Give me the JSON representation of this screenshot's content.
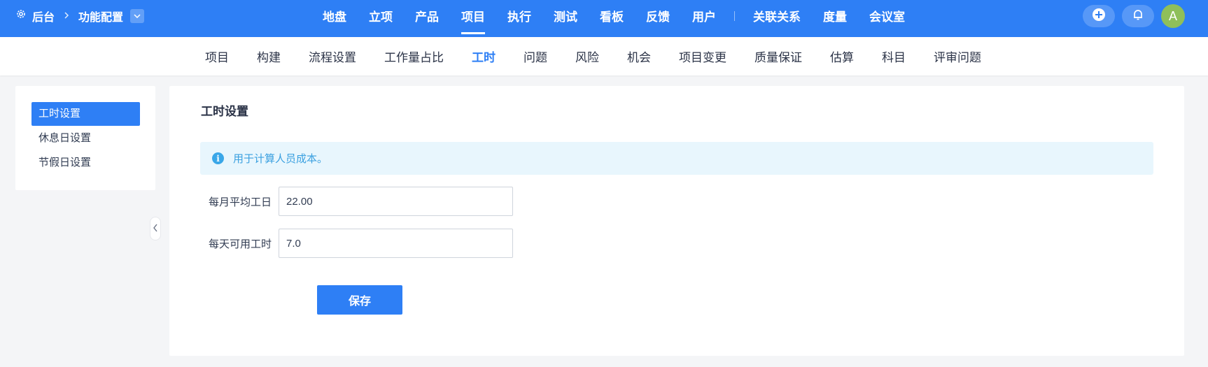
{
  "header": {
    "breadcrumb_home": "后台",
    "breadcrumb_section": "功能配置",
    "nav": [
      "地盘",
      "立项",
      "产品",
      "项目",
      "执行",
      "测试",
      "看板",
      "反馈",
      "用户"
    ],
    "nav_extra": [
      "关联关系",
      "度量",
      "会议室"
    ],
    "active_nav": "项目",
    "avatar_letter": "A"
  },
  "subnav": {
    "items": [
      "项目",
      "构建",
      "流程设置",
      "工作量占比",
      "工时",
      "问题",
      "风险",
      "机会",
      "项目变更",
      "质量保证",
      "估算",
      "科目",
      "评审问题"
    ],
    "active": "工时"
  },
  "sidebar": {
    "items": [
      {
        "label": "工时设置",
        "active": true
      },
      {
        "label": "休息日设置",
        "active": false
      },
      {
        "label": "节假日设置",
        "active": false
      }
    ]
  },
  "main": {
    "title": "工时设置",
    "alert": "用于计算人员成本。",
    "fields": [
      {
        "label": "每月平均工日",
        "value": "22.00"
      },
      {
        "label": "每天可用工时",
        "value": "7.0"
      }
    ],
    "save_label": "保存"
  },
  "colors": {
    "primary": "#2e7ff5",
    "alert_bg": "#e8f6fd",
    "alert_text": "#3aa0e0",
    "avatar_bg": "#8fbf5a"
  },
  "icons": [
    "gear-icon",
    "chevron-right-icon",
    "chevron-down-icon",
    "plus-icon",
    "bell-icon",
    "info-icon",
    "chevron-left-icon"
  ]
}
